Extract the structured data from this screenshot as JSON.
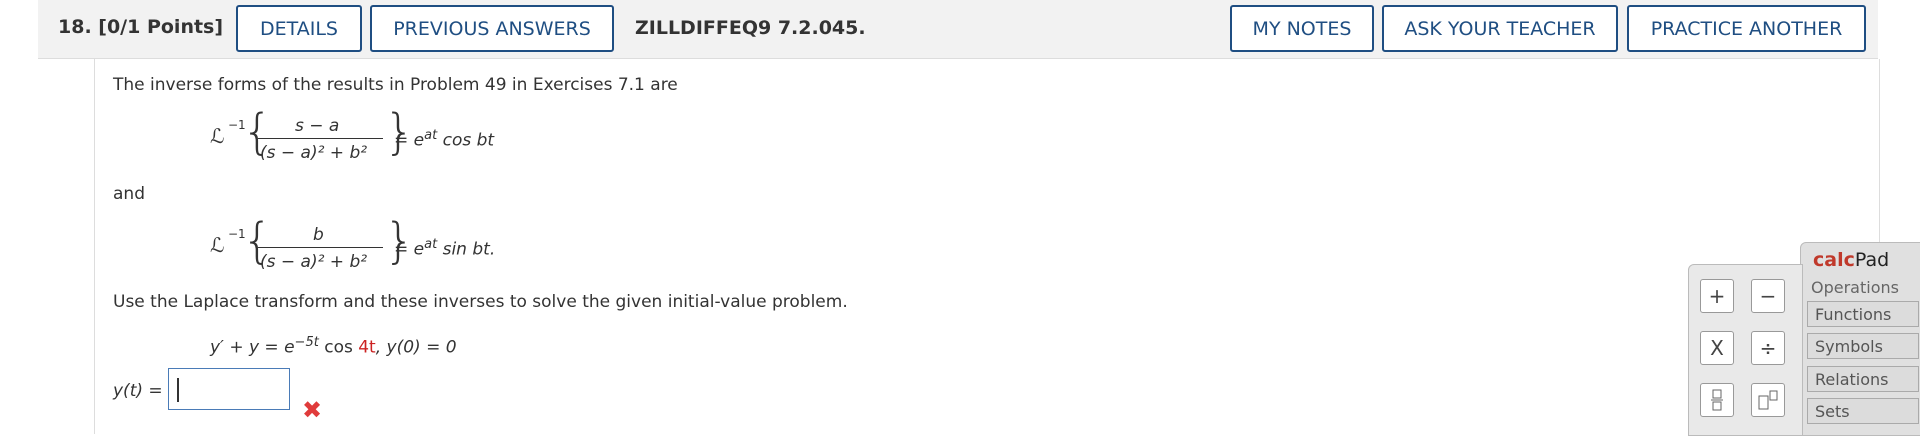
{
  "header": {
    "question_label": "18.  [0/1 Points]",
    "details": "DETAILS",
    "previous_answers": "PREVIOUS ANSWERS",
    "problem_code": "ZILLDIFFEQ9 7.2.045.",
    "my_notes": "MY NOTES",
    "ask_teacher": "ASK YOUR TEACHER",
    "practice_another": "PRACTICE ANOTHER"
  },
  "problem": {
    "intro": "The inverse forms of the results in Problem 49 in Exercises 7.1 are",
    "eq1_numerator": "s − a",
    "eq1_rhs_trig": " cos bt",
    "and": "and",
    "eq2_numerator": "b",
    "eq2_rhs_trig": " sin bt.",
    "denominator": "(s − a)² + b²",
    "instruction": "Use the Laplace transform and these inverses to solve the given initial-value problem.",
    "ivp_lhs": "y′ + y = e",
    "ivp_exp": "−5t",
    "ivp_cos": " cos ",
    "ivp_coef": "4t",
    "ivp_ic": ",    y(0) = 0",
    "answer_label": "y(t) =",
    "answer_value": "",
    "status_icon": "x-mark-icon"
  },
  "calcpad": {
    "title_bold": "calc",
    "title_rest": "Pad",
    "operations": "Operations",
    "tabs": [
      "Functions",
      "Symbols",
      "Relations",
      "Sets"
    ],
    "keys": [
      "+",
      "−",
      "X",
      "÷"
    ]
  }
}
